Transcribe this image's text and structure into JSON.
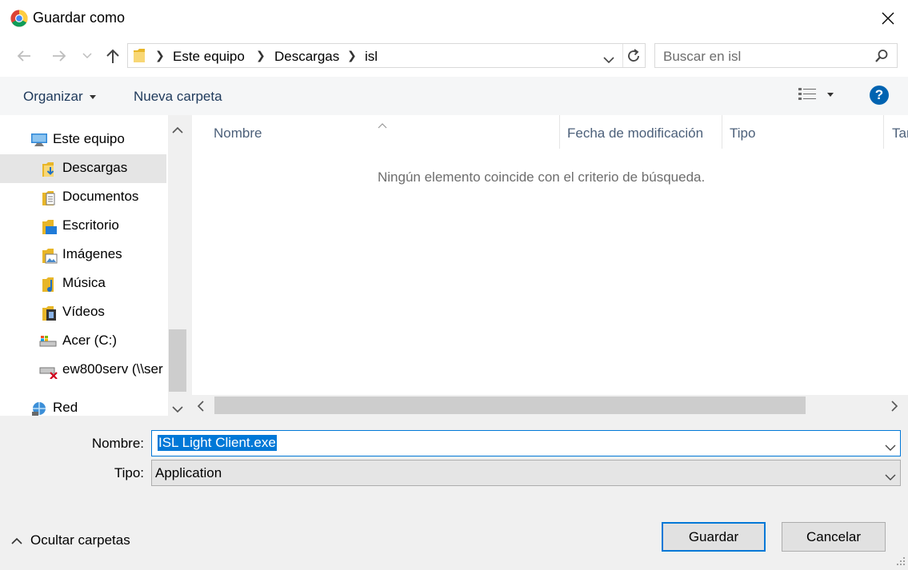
{
  "window": {
    "title": "Guardar como"
  },
  "address": {
    "breadcrumbs": [
      "Este equipo",
      "Descargas",
      "isl"
    ]
  },
  "search": {
    "placeholder": "Buscar en isl"
  },
  "toolbar": {
    "organize_label": "Organizar",
    "new_folder_label": "Nueva carpeta",
    "help_label": "?"
  },
  "nav": {
    "items": [
      {
        "label": "Este equipo",
        "icon": "computer-icon"
      },
      {
        "label": "Descargas",
        "icon": "downloads-folder-icon",
        "selected": true
      },
      {
        "label": "Documentos",
        "icon": "documents-folder-icon"
      },
      {
        "label": "Escritorio",
        "icon": "desktop-folder-icon"
      },
      {
        "label": "Imágenes",
        "icon": "pictures-folder-icon"
      },
      {
        "label": "Música",
        "icon": "music-folder-icon"
      },
      {
        "label": "Vídeos",
        "icon": "videos-folder-icon"
      },
      {
        "label": "Acer (C:)",
        "icon": "drive-icon"
      },
      {
        "label": "ew800serv (\\\\ser",
        "icon": "network-drive-disconnected-icon"
      },
      {
        "label": "Red",
        "icon": "network-icon"
      }
    ]
  },
  "content": {
    "columns": [
      "Nombre",
      "Fecha de modificación",
      "Tipo",
      "Tar"
    ],
    "empty_message": "Ningún elemento coincide con el criterio de búsqueda."
  },
  "form": {
    "name_label": "Nombre:",
    "name_value": "ISL Light Client.exe",
    "type_label": "Tipo:",
    "type_value": "Application"
  },
  "buttons": {
    "save": "Guardar",
    "cancel": "Cancelar",
    "hide_folders": "Ocultar carpetas"
  },
  "colors": {
    "accent": "#0078d7",
    "selection": "#e5e5e5",
    "help": "#0063b1"
  }
}
